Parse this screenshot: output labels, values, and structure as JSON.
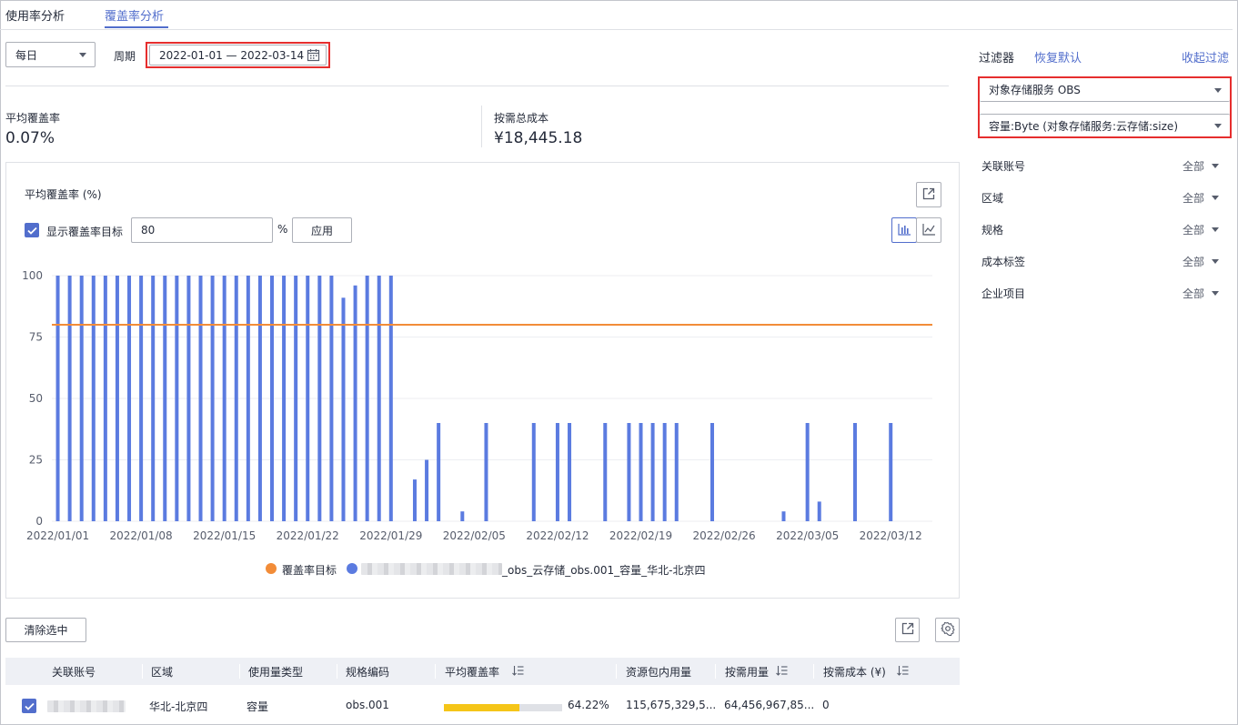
{
  "tabs": [
    {
      "label": "使用率分析",
      "active": false
    },
    {
      "label": "覆盖率分析",
      "active": true
    }
  ],
  "toolbar": {
    "granularity": "每日",
    "period_label": "周期",
    "period_value": "2022-01-01 — 2022-03-14"
  },
  "kpis": {
    "avg_coverage_label": "平均覆盖率",
    "avg_coverage_value": "0.07%",
    "total_cost_label": "按需总成本",
    "total_cost_value": "¥18,445.18"
  },
  "chart_panel": {
    "title": "平均覆盖率 (%)",
    "show_target_label": "显示覆盖率目标",
    "show_target_checked": true,
    "target_value": "80",
    "percent_sign": "%",
    "apply_label": "应用"
  },
  "chart_data": {
    "type": "bar",
    "title": "平均覆盖率 (%)",
    "ylim": [
      0,
      100
    ],
    "yticks": [
      0,
      25,
      50,
      75,
      100
    ],
    "xtick_labels": [
      "2022/01/01",
      "2022/01/08",
      "2022/01/15",
      "2022/01/22",
      "2022/01/29",
      "2022/02/05",
      "2022/02/12",
      "2022/02/19",
      "2022/02/26",
      "2022/03/05",
      "2022/03/12"
    ],
    "target": 80,
    "target_color": "#f28c38",
    "bar_color": "#5b7be0",
    "series": [
      {
        "name": "_obs_云存储_obs.001_容量_华北-北京四",
        "values": [
          100,
          100,
          100,
          100,
          100,
          100,
          100,
          100,
          100,
          100,
          100,
          100,
          100,
          100,
          100,
          100,
          100,
          100,
          100,
          100,
          100,
          100,
          100,
          100,
          91,
          96,
          100,
          100,
          100,
          0,
          17,
          25,
          40,
          0,
          4,
          0,
          40,
          0,
          0,
          0,
          40,
          0,
          40,
          40,
          0,
          0,
          40,
          0,
          40,
          40,
          40,
          40,
          40,
          0,
          0,
          40,
          0,
          0,
          0,
          0,
          0,
          4,
          0,
          40,
          8,
          0,
          0,
          40,
          0,
          0,
          40,
          0,
          0,
          0
        ]
      }
    ],
    "legend": [
      {
        "label": "覆盖率目标",
        "color": "#f28c38"
      },
      {
        "label": "_obs_云存储_obs.001_容量_华北-北京四",
        "color": "#5b7be0"
      }
    ]
  },
  "filters": {
    "title": "过滤器",
    "reset_label": "恢复默认",
    "collapse_label": "收起过滤",
    "service_select": "对象存储服务 OBS",
    "usage_select": "容量:Byte (对象存储服务:云存储:size)",
    "items": [
      {
        "label": "关联账号",
        "value": "全部"
      },
      {
        "label": "区域",
        "value": "全部"
      },
      {
        "label": "规格",
        "value": "全部"
      },
      {
        "label": "成本标签",
        "value": "全部"
      },
      {
        "label": "企业项目",
        "value": "全部"
      }
    ]
  },
  "table": {
    "clear_label": "清除选中",
    "columns": [
      "关联账号",
      "区域",
      "使用量类型",
      "规格编码",
      "平均覆盖率",
      "资源包内用量",
      "按需用量",
      "按需成本 (¥)"
    ],
    "rows": [
      {
        "checked": true,
        "account": "",
        "region": "华北-北京四",
        "usage_type": "容量",
        "spec": "obs.001",
        "coverage": "64.22%",
        "coverage_fraction": 0.6422,
        "package_usage": "115,675,329,5...",
        "ondemand_usage": "64,456,967,85...",
        "ondemand_cost": "0"
      }
    ]
  }
}
